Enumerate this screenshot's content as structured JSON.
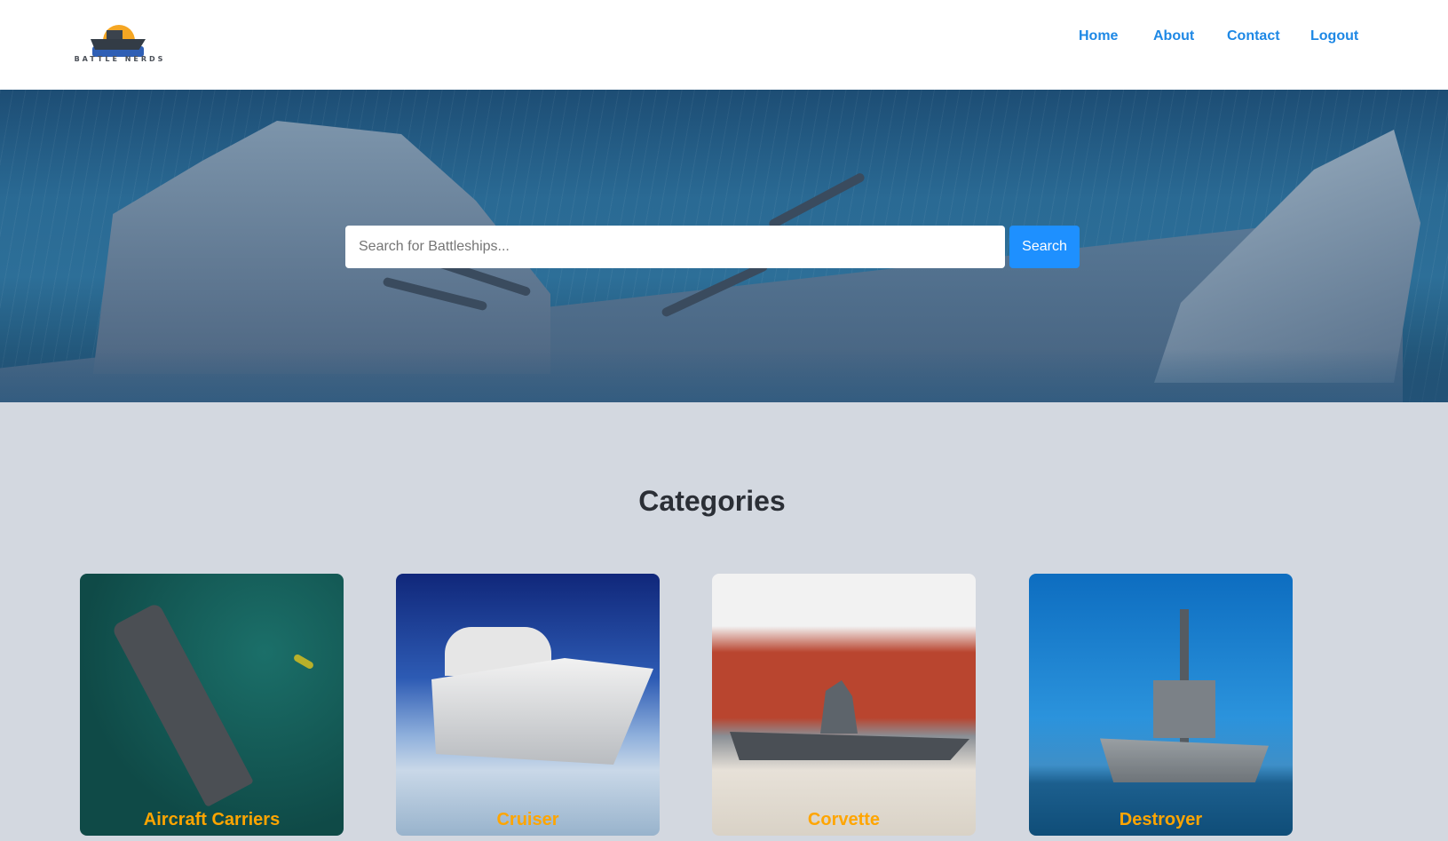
{
  "header": {
    "logo_text": "BATTLE NERDS",
    "nav": [
      {
        "label": "Home"
      },
      {
        "label": "About"
      },
      {
        "label": "Contact"
      },
      {
        "label": "Logout"
      }
    ]
  },
  "hero": {
    "search": {
      "placeholder": "Search for Battleships...",
      "value": ""
    },
    "search_button_label": "Search"
  },
  "categories": {
    "title": "Categories",
    "items": [
      {
        "label": "Aircraft Carriers"
      },
      {
        "label": "Cruiser"
      },
      {
        "label": "Corvette"
      },
      {
        "label": "Destroyer"
      }
    ]
  },
  "colors": {
    "nav_link": "#1e88e5",
    "search_button": "#1e90ff",
    "category_label": "#ffa500",
    "page_background": "#d3d8e0"
  }
}
